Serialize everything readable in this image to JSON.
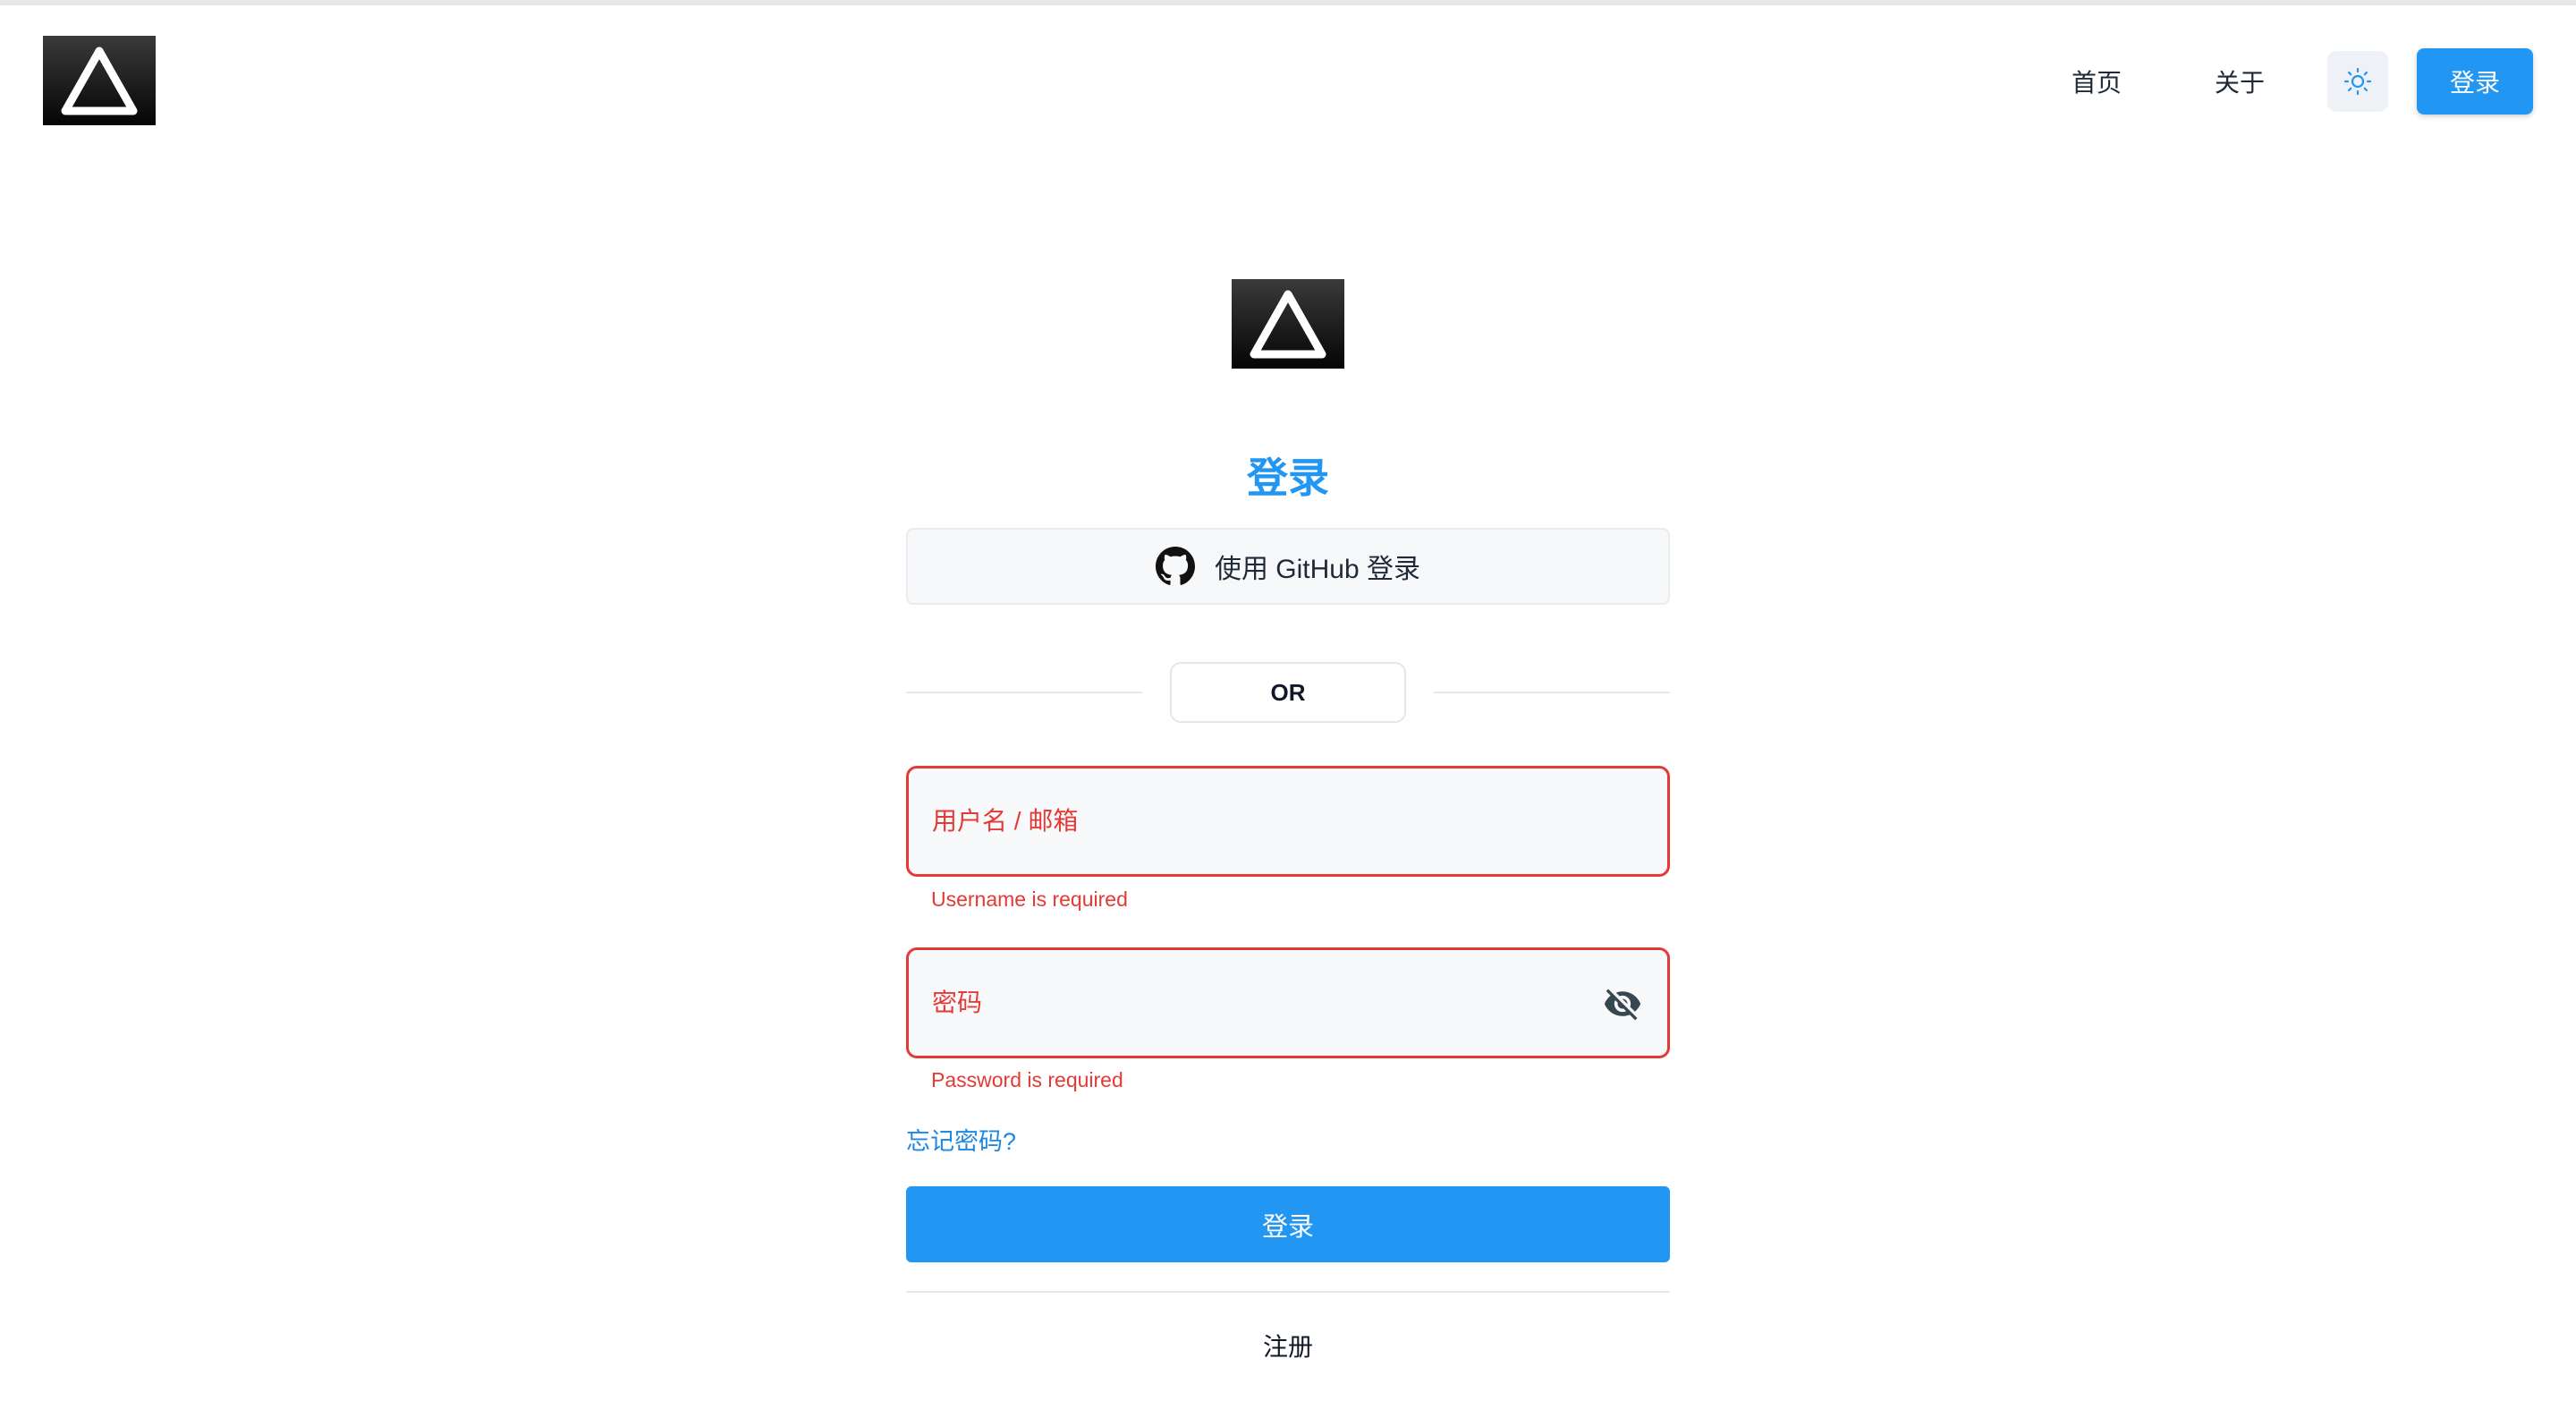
{
  "header": {
    "nav": [
      {
        "label": "首页"
      },
      {
        "label": "关于"
      }
    ],
    "theme_icon": "sun-icon",
    "login_label": "登录"
  },
  "login": {
    "title": "登录",
    "github_label": "使用 GitHub 登录",
    "divider_text": "OR",
    "username": {
      "placeholder": "用户名 / 邮箱",
      "value": "",
      "error": "Username is required"
    },
    "password": {
      "placeholder": "密码",
      "value": "",
      "error": "Password is required",
      "toggle_icon": "eye-off-icon"
    },
    "forgot_label": "忘记密码?",
    "submit_label": "登录",
    "register_label": "注册"
  },
  "colors": {
    "accent": "#2196f3",
    "error": "#e53935",
    "logo_bg": "#1a1a1a"
  }
}
